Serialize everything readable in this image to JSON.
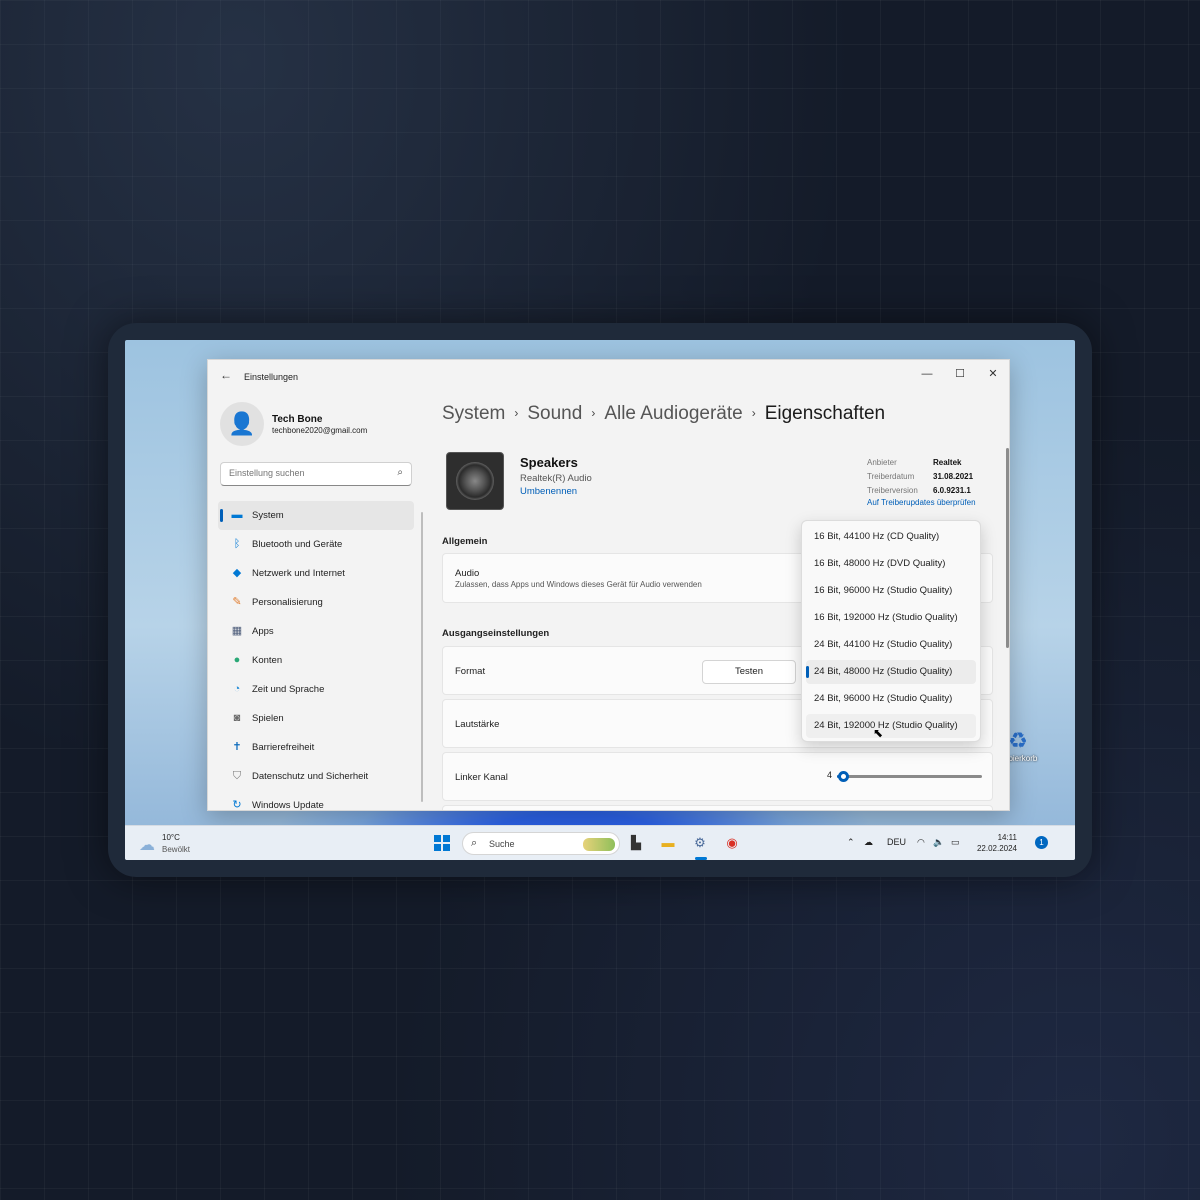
{
  "window": {
    "app_title": "Einstellungen",
    "controls": {
      "minimize": "—",
      "maximize": "☐",
      "close": "✕"
    }
  },
  "profile": {
    "name": "Tech Bone",
    "email": "techbone2020@gmail.com"
  },
  "search": {
    "placeholder": "Einstellung suchen"
  },
  "nav": [
    {
      "label": "System",
      "icon": "monitor-icon",
      "color": "#0078d4",
      "active": true
    },
    {
      "label": "Bluetooth und Geräte",
      "icon": "bluetooth-icon",
      "color": "#0078d4"
    },
    {
      "label": "Netzwerk und Internet",
      "icon": "wifi-icon",
      "color": "#0078d4"
    },
    {
      "label": "Personalisierung",
      "icon": "brush-icon",
      "color": "#e07a2a"
    },
    {
      "label": "Apps",
      "icon": "apps-icon",
      "color": "#4a5a78"
    },
    {
      "label": "Konten",
      "icon": "person-icon",
      "color": "#2aa876"
    },
    {
      "label": "Zeit und Sprache",
      "icon": "globe-clock-icon",
      "color": "#2a8fd6"
    },
    {
      "label": "Spielen",
      "icon": "gamepad-icon",
      "color": "#6b6b6b"
    },
    {
      "label": "Barrierefreiheit",
      "icon": "accessibility-icon",
      "color": "#0f6cbd"
    },
    {
      "label": "Datenschutz und Sicherheit",
      "icon": "shield-icon",
      "color": "#7a7a7a"
    },
    {
      "label": "Windows Update",
      "icon": "update-icon",
      "color": "#0078d4"
    }
  ],
  "breadcrumb": [
    "System",
    "Sound",
    "Alle Audiogeräte",
    "Eigenschaften"
  ],
  "device": {
    "name": "Speakers",
    "subtitle": "Realtek(R) Audio",
    "rename": "Umbenennen"
  },
  "driver": {
    "labels": [
      "Anbieter",
      "Treiberdatum",
      "Treiberversion"
    ],
    "values": [
      "Realtek",
      "31.08.2021",
      "6.0.9231.1"
    ],
    "update_link": "Auf Treiberupdates überprüfen"
  },
  "general": {
    "heading": "Allgemein",
    "audio_label": "Audio",
    "audio_desc": "Zulassen, dass Apps und Windows dieses Gerät für Audio verwenden"
  },
  "output": {
    "heading": "Ausgangseinstellungen",
    "format_label": "Format",
    "test_button": "Testen",
    "volume_label": "Lautstärke",
    "left_channel_label": "Linker Kanal",
    "left_channel_value": "4"
  },
  "format_options": [
    "16 Bit, 44100 Hz (CD Quality)",
    "16 Bit, 48000 Hz (DVD Quality)",
    "16 Bit, 96000 Hz (Studio Quality)",
    "16 Bit, 192000 Hz (Studio Quality)",
    "24 Bit, 44100 Hz (Studio Quality)",
    "24 Bit, 48000 Hz (Studio Quality)",
    "24 Bit, 96000 Hz (Studio Quality)",
    "24 Bit, 192000 Hz (Studio Quality)"
  ],
  "format_selected_index": 5,
  "format_hover_index": 7,
  "taskbar": {
    "weather_temp": "10°C",
    "weather_desc": "Bewölkt",
    "search_label": "Suche",
    "language": "DEU",
    "time": "14:11",
    "date": "22.02.2024",
    "notifications": "1"
  },
  "desktop": {
    "recycle_label": "Papierkorb"
  },
  "colors": {
    "accent": "#005fb8",
    "taskbar_blue": "#0078d4"
  }
}
